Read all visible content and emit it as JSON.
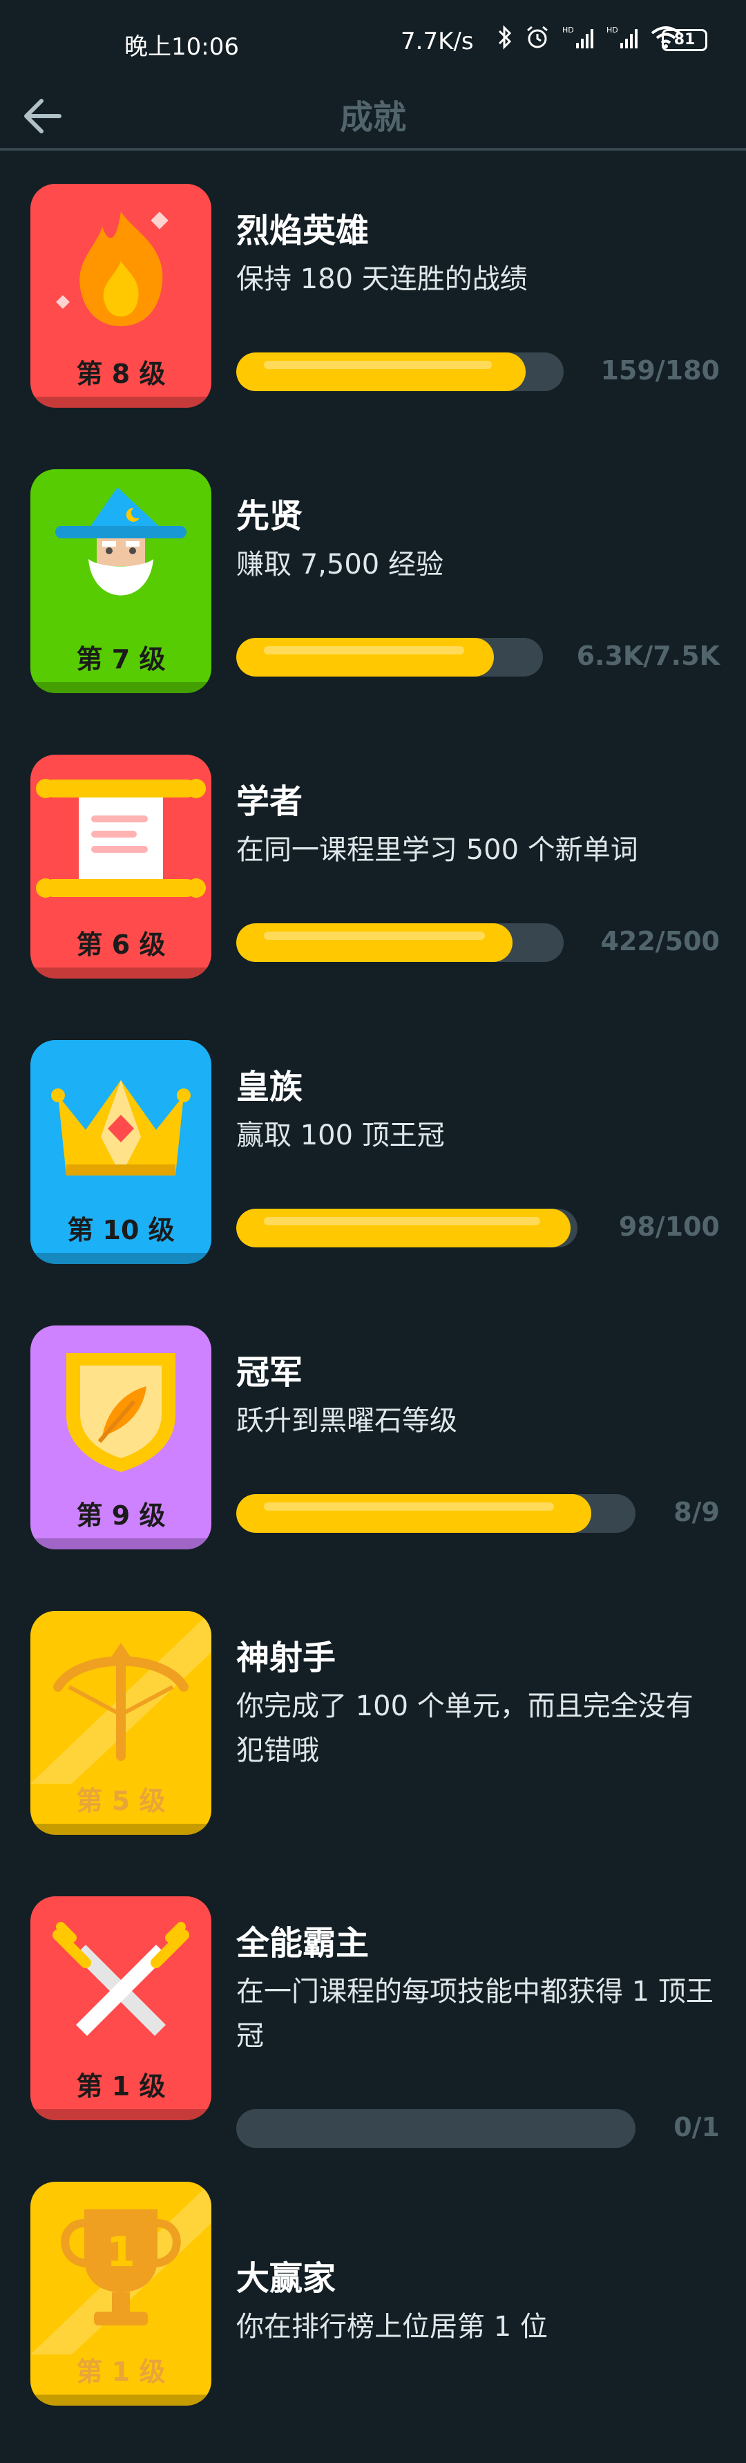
{
  "status_bar": {
    "time": "晚上10:06",
    "network_speed": "7.7K/s",
    "battery": "81"
  },
  "header": {
    "title": "成就"
  },
  "achievements": [
    {
      "title": "烈焰英雄",
      "description": "保持 180 天连胜的战绩",
      "level": "第 8 级",
      "progress_text": "159/180",
      "progress": 0.883,
      "badge_color": "#ff4b4b",
      "icon": "flame-icon"
    },
    {
      "title": "先贤",
      "description": "赚取 7,500 经验",
      "level": "第 7 级",
      "progress_text": "6.3K/7.5K",
      "progress": 0.84,
      "badge_color": "#58cc02",
      "icon": "wizard-icon"
    },
    {
      "title": "学者",
      "description": "在同一课程里学习 500 个新单词",
      "level": "第 6 级",
      "progress_text": "422/500",
      "progress": 0.844,
      "badge_color": "#ff4b4b",
      "icon": "scroll-icon"
    },
    {
      "title": "皇族",
      "description": "赢取 100 顶王冠",
      "level": "第 10 级",
      "progress_text": "98/100",
      "progress": 0.98,
      "badge_color": "#1cb0f6",
      "icon": "crown-icon"
    },
    {
      "title": "冠军",
      "description": "跃升到黑曜石等级",
      "level": "第 9 级",
      "progress_text": "8/9",
      "progress": 0.889,
      "badge_color": "#ce82ff",
      "icon": "shield-icon"
    },
    {
      "title": "神射手",
      "description": "你完成了 100 个单元，而且完全没有犯错哦",
      "level": "第 5 级",
      "progress_text": "",
      "progress": null,
      "badge_color": "#ffc800",
      "icon": "crossbow-icon",
      "locked": true
    },
    {
      "title": "全能霸主",
      "description": "在一门课程的每项技能中都获得 1 顶王冠",
      "level": "第 1 级",
      "progress_text": "0/1",
      "progress": 0,
      "badge_color": "#ff4b4b",
      "icon": "crossed-swords-icon"
    },
    {
      "title": "大赢家",
      "description": "你在排行榜上位居第 1 位",
      "level": "第 1 级",
      "progress_text": "",
      "progress": null,
      "badge_color": "#ffc800",
      "icon": "trophy-icon",
      "locked": true
    }
  ]
}
